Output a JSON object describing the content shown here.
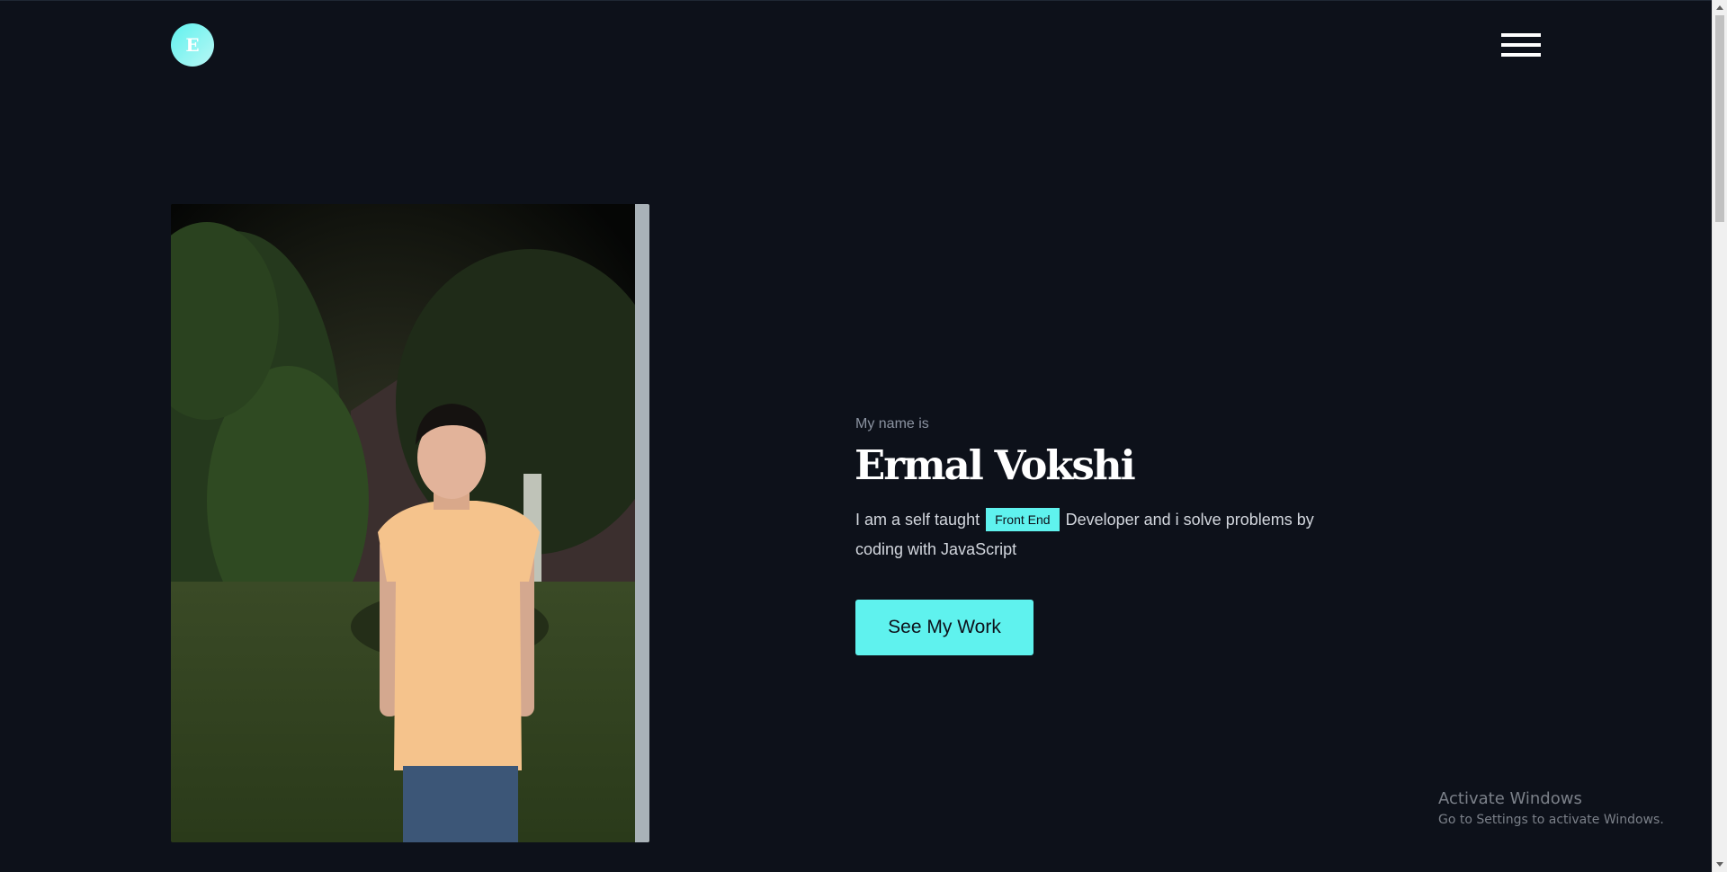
{
  "header": {
    "logo_letter": "E",
    "menu_icon": "hamburger-menu-icon"
  },
  "photo": {
    "description_icon": "profile-photo"
  },
  "intro": {
    "label": "My name is",
    "name": "Ermal Vokshi",
    "desc_before": "I am a self taught",
    "highlight": "Front End",
    "desc_after": "Developer and i solve problems by coding with JavaScript",
    "cta_label": "See My Work"
  },
  "watermark": {
    "title": "Activate Windows",
    "subtitle": "Go to Settings to activate Windows."
  },
  "colors": {
    "background": "#0d111a",
    "accent": "#5ff2ee",
    "text": "#ffffff",
    "muted": "#8b93a1"
  }
}
